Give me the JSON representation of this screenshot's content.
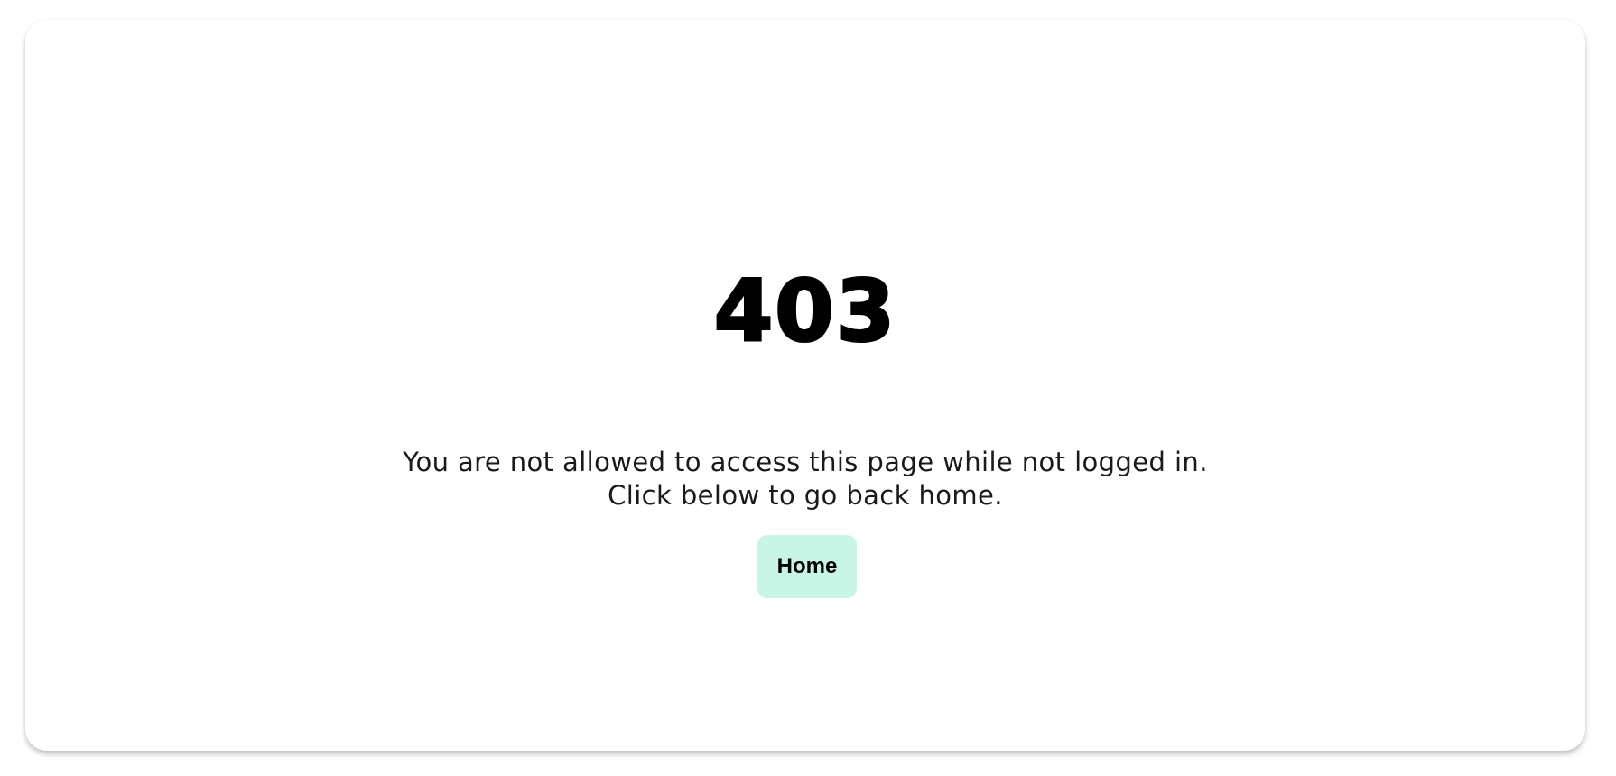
{
  "error": {
    "code": "403",
    "message_line1": "You are not allowed to access this page while not logged in.",
    "message_line2": "Click below to go back home."
  },
  "actions": {
    "home_label": "Home"
  },
  "colors": {
    "button_background": "#c8f5e6",
    "text": "#000000",
    "card_background": "#ffffff"
  }
}
